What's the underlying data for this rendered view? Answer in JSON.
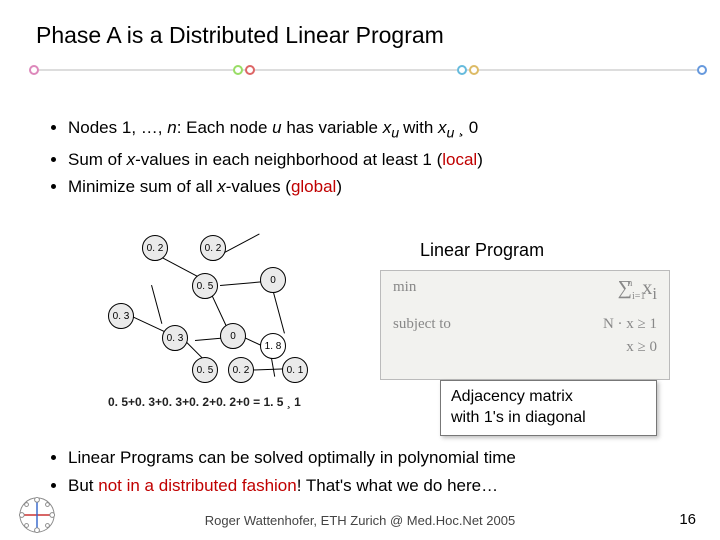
{
  "title": "Phase A is a Distributed Linear Program",
  "bullets_top": {
    "b1_pre": "Nodes 1, …, ",
    "b1_n": "n",
    "b1_mid": ": Each node ",
    "b1_u": "u",
    "b1_hasvar": " has variable ",
    "b1_xu": "x",
    "b1_usub": "u ",
    "b1_with": "with ",
    "b1_xu2": "x",
    "b1_usub2": "u ",
    "b1_cond": " ¸ 0",
    "b2_pre": "Sum of ",
    "b2_x": "x",
    "b2_mid": "-values in each neighborhood at least 1 (",
    "b2_local": "local",
    "b2_post": ")",
    "b3_pre": "Minimize sum of all ",
    "b3_x": "x",
    "b3_mid": "-values (",
    "b3_global": "global",
    "b3_post": ")"
  },
  "nodes": {
    "a": "0. 2",
    "b": "0. 2",
    "c": "0. 5",
    "d": "0",
    "e": "0. 3",
    "f": "0. 3",
    "g": "0",
    "h": "1. 8",
    "i": "0. 5",
    "j": "0. 2",
    "k": "0. 1"
  },
  "equation": "0. 5+0. 3+0. 3+0. 2+0. 2+0 = 1. 5 ¸ 1",
  "lp": {
    "heading": "Linear Program",
    "min": "min",
    "sum": "∑ xᵢ",
    "subj": "subject to",
    "c1": "N · x ≥ 1",
    "c2": "x ≥ 0"
  },
  "adj": {
    "l1": "Adjacency matrix",
    "l2": "with 1's in diagonal"
  },
  "bullets_bottom": {
    "b1": "Linear Programs can be solved optimally in polynomial time",
    "b2_pre": "But ",
    "b2_red": "not in a distributed fashion",
    "b2_post": "! That's what we do here…"
  },
  "footer": "Roger Wattenhofer, ETH Zurich @ Med.Hoc.Net 2005",
  "page": "16"
}
